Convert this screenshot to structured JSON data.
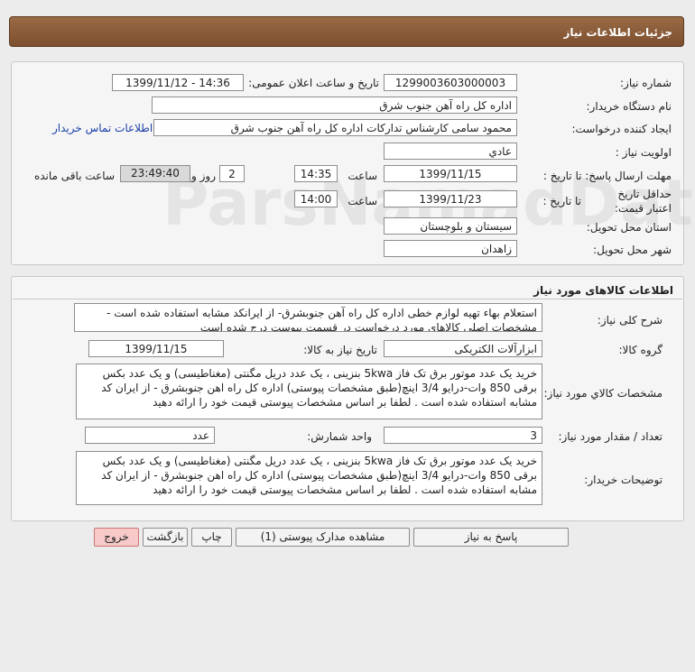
{
  "title": "جزئیات اطلاعات نیاز",
  "info": {
    "need_number_label": "شماره نیاز:",
    "need_number": "1299003603000003",
    "announce_label": "تاریخ و ساعت اعلان عمومی:",
    "announce_value": "1399/11/12 - 14:36",
    "buyer_label": "نام دستگاه خریدار:",
    "buyer_value": "اداره کل راه آهن جنوب شرق",
    "creator_label": "ایجاد کننده درخواست:",
    "creator_value": "محمود سامی  کارشناس تدارکات  اداره کل راه آهن جنوب شرق",
    "contact_link": "اطلاعات تماس خریدار",
    "priority_label": "اولویت نیاز :",
    "priority_value": "عادي",
    "deadline_label": "مهلت ارسال پاسخ:  تا تاریخ :",
    "deadline_date": "1399/11/15",
    "time_label": "ساعت",
    "deadline_time": "14:35",
    "days_value": "2",
    "days_label": "روز و",
    "remaining_time": "23:49:40",
    "remaining_label": "ساعت باقی مانده",
    "validity_label": "حداقل تاریخ اعتبار قیمت:",
    "validity_prefix": "تا تاریخ :",
    "validity_date": "1399/11/23",
    "validity_time": "14:00",
    "province_label": "استان محل تحویل:",
    "province_value": "سیستان و بلوچستان",
    "city_label": "شهر محل تحویل:",
    "city_value": "زاهدان"
  },
  "goods": {
    "section_title": "اطلاعات کالاهای مورد نیاز",
    "desc_label": "شرح کلی نیاز:",
    "desc_value": "استعلام بهاء تهیه لوازم خطی اداره کل راه آهن جنوبشرق- از ایرانکد مشابه استفاده شده است - مشخصات اصلی کالاهای مورد درخواست در قسمت پیوست درج شده است",
    "group_label": "گروه کالا:",
    "group_value": "ابزارآلات الکتریکی",
    "need_date_label": "تاریخ نیاز به کالا:",
    "need_date_value": "1399/11/15",
    "spec_label": "مشخصات کالاي مورد نياز:",
    "spec_value": "خرید یک عدد موتور برق تک فاز 5kwa بنزینی ، یک عدد دریل مگنتی (مغناطیسی) و یک عدد بکس برقی 850 وات-درایو 3/4 اینچ(طبق مشخصات پیوستی) اداره کل راه اهن جنوبشرق - از ایران کد مشابه استفاده شده است . لطفا بر اساس مشخصات  پیوستی قیمت خود را ارائه دهید",
    "qty_label": "تعداد / مقدار مورد نیاز:",
    "qty_value": "3",
    "unit_label": "واحد شمارش:",
    "unit_value": "عدد",
    "buyer_desc_label": "توضیحات خریدار:",
    "buyer_desc_value": "خرید یک عدد موتور برق تک فاز 5kwa بنزینی ، یک عدد دریل مگنتی (مغناطیسی) و یک عدد بکس برقی 850 وات-درایو 3/4 اینچ(طبق مشخصات پیوستی) اداره کل راه اهن جنوبشرق - از ایران کد مشابه استفاده شده است . لطفا بر اساس مشخصات  پیوستی قیمت خود را ارائه دهید"
  },
  "buttons": {
    "reply": "پاسخ به نیاز",
    "attachments": "مشاهده مدارک پیوستی (1)",
    "print": "چاپ",
    "back": "بازگشت",
    "exit": "خروج"
  },
  "colors": {
    "header_bg": "#8a5a37",
    "exit_bg": "#f7c9c9",
    "link": "#1a3fa8"
  }
}
